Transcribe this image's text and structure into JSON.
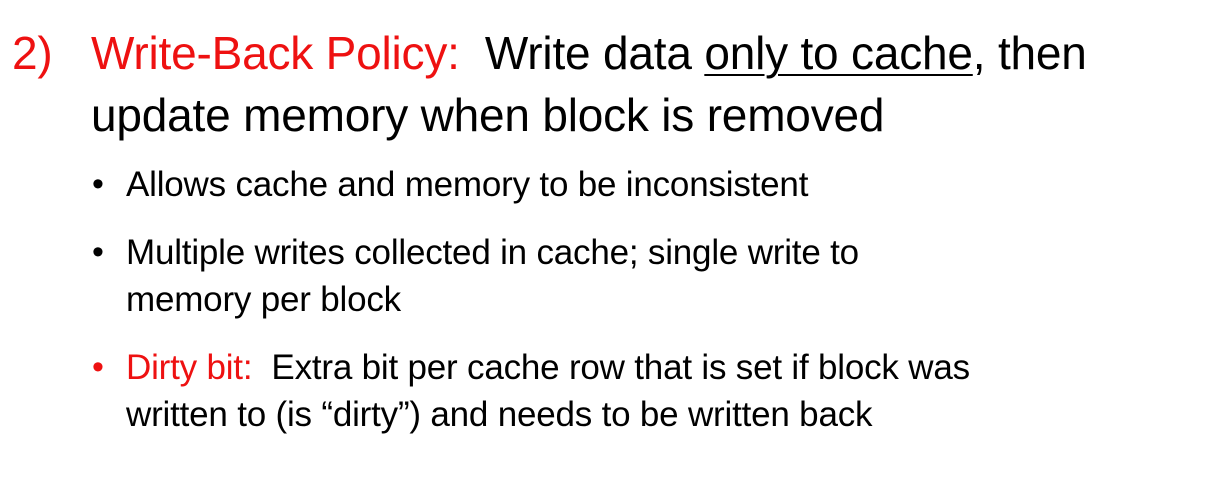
{
  "main_point": {
    "number": "2)",
    "term": "Write-Back Policy:",
    "text_before_underline": "Write data ",
    "underlined": "only to cache",
    "text_after_underline": ", then",
    "line2": "update memory when block is removed"
  },
  "bullets": [
    {
      "symbol": "•",
      "lines": [
        "Allows cache and memory to be inconsistent"
      ]
    },
    {
      "symbol": "•",
      "lines": [
        "Multiple writes collected in cache; single write to",
        "memory per block"
      ]
    },
    {
      "symbol": "•",
      "term": "Dirty bit:",
      "lines": [
        "Extra bit per cache row that is set if block was",
        "written to (is “dirty”) and needs to be written back"
      ]
    }
  ],
  "colors": {
    "accent_red": "#ee1111",
    "text": "#000000",
    "background": "#ffffff"
  }
}
